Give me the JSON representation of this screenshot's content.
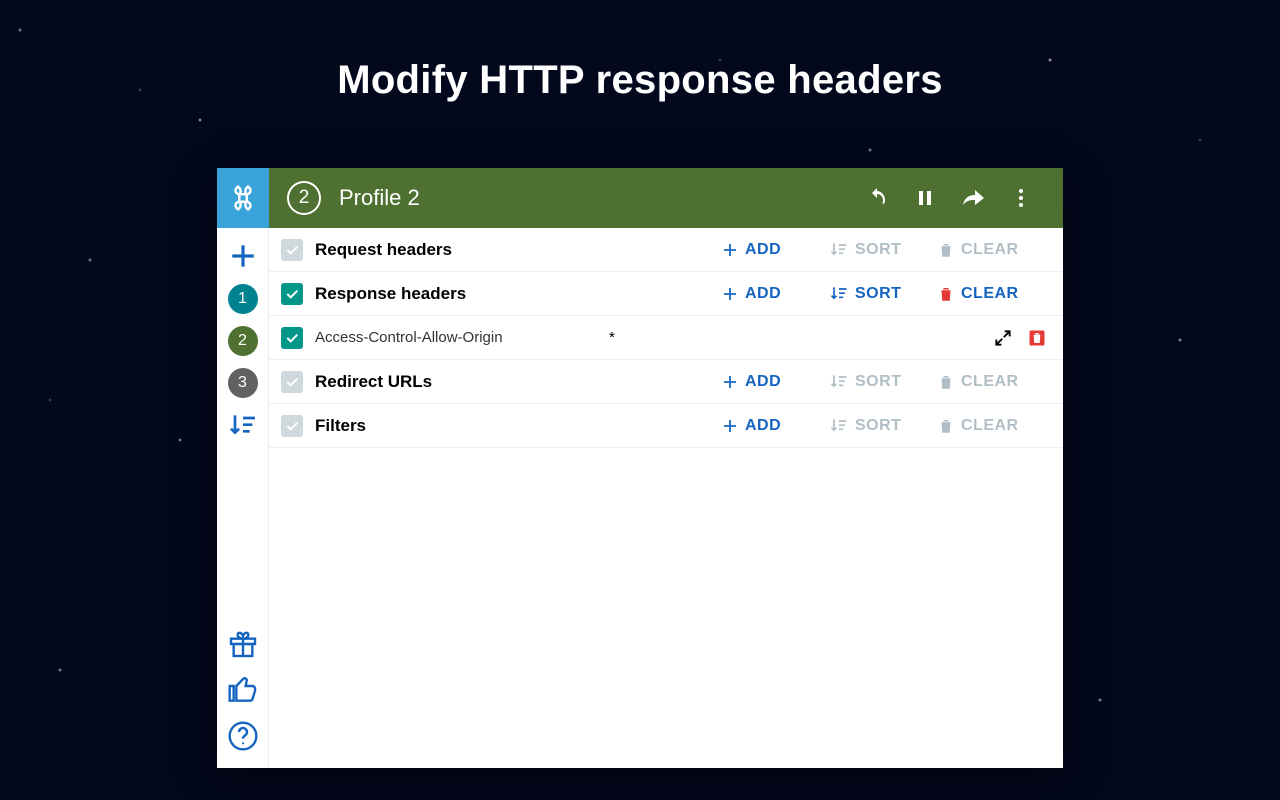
{
  "hero_title": "Modify HTTP response headers",
  "toolbar": {
    "profile_number": "2",
    "profile_title": "Profile 2"
  },
  "side": {
    "profile_1": "1",
    "profile_2": "2",
    "profile_3": "3"
  },
  "actions": {
    "add": "ADD",
    "sort": "SORT",
    "clear": "CLEAR"
  },
  "sections": [
    {
      "key": "request",
      "title": "Request headers",
      "checked": false,
      "sort_enabled": false,
      "clear_enabled": false
    },
    {
      "key": "response",
      "title": "Response headers",
      "checked": true,
      "sort_enabled": true,
      "clear_enabled": true
    },
    {
      "key": "redirect",
      "title": "Redirect URLs",
      "checked": false,
      "sort_enabled": false,
      "clear_enabled": false
    },
    {
      "key": "filters",
      "title": "Filters",
      "checked": false,
      "sort_enabled": false,
      "clear_enabled": false
    }
  ],
  "response_items": [
    {
      "name": "Access-Control-Allow-Origin",
      "value": "*",
      "checked": true
    }
  ],
  "colors": {
    "accent_blue": "#1565c0",
    "toolbar_green": "#4e7031",
    "teal": "#009688",
    "red": "#e53935"
  }
}
